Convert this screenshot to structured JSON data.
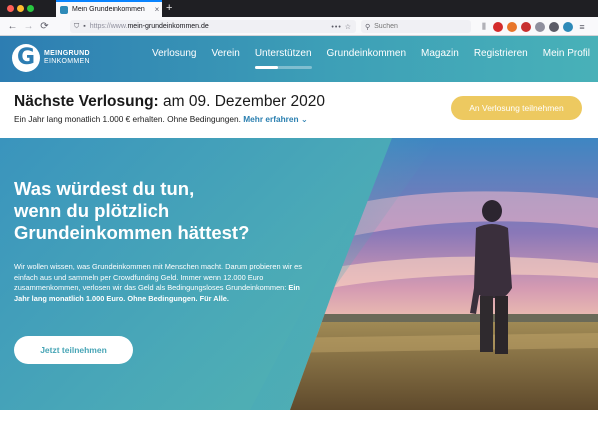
{
  "browser": {
    "tab_title": "Mein Grundeinkommen",
    "tab_close": "×",
    "new_tab": "+",
    "url_prefix": "https://www.",
    "url_host": "mein-grundeinkommen.de",
    "search_placeholder": "Suchen",
    "back": "←",
    "forward": "→",
    "reload": "⟳",
    "page_actions": "••• ☆",
    "icons": [
      "library-icon",
      "ublock-icon",
      "extension-icon",
      "extension-icon",
      "sync-icon",
      "account-icon",
      "container-icon",
      "menu-icon"
    ]
  },
  "site": {
    "logo_top": "MEINGRUND",
    "logo_bottom": "EINKOMMEN",
    "logo_letter": "G",
    "nav": [
      {
        "label": "Verlosung"
      },
      {
        "label": "Verein"
      },
      {
        "label": "Unterstützen",
        "active": true
      },
      {
        "label": "Grundeinkommen"
      },
      {
        "label": "Magazin"
      },
      {
        "label": "Registrieren"
      },
      {
        "label": "Mein Profil"
      }
    ]
  },
  "announcement": {
    "title_bold": "Nächste Verlosung:",
    "title_rest": " am 09. Dezember 2020",
    "subtitle": "Ein Jahr lang monatlich 1.000 € erhalten. Ohne Bedingungen.",
    "more_link": "Mehr erfahren",
    "more_arrow": "⌄",
    "cta": "An Verlosung teilnehmen"
  },
  "hero": {
    "headline_1": "Was würdest du tun,",
    "headline_2": "wenn du plötzlich",
    "headline_3": "Grundeinkommen hättest?",
    "body_plain": "Wir wollen wissen, was Grundeinkommen mit Menschen macht. Darum probieren wir es einfach aus und sammeln per Crowdfunding Geld. Immer wenn 12.000 Euro zusammenkommen, verlosen wir das Geld als Bedingungsloses Grundeinkommen: ",
    "body_bold": "Ein Jahr lang monatlich 1.000 Euro. Ohne Bedingungen. Für Alle.",
    "cta": "Jetzt teilnehmen"
  },
  "colors": {
    "brand_blue": "#2d7db2",
    "brand_teal": "#48b1b8",
    "cta_yellow": "#edc960",
    "link_blue": "#2a7fb0"
  }
}
